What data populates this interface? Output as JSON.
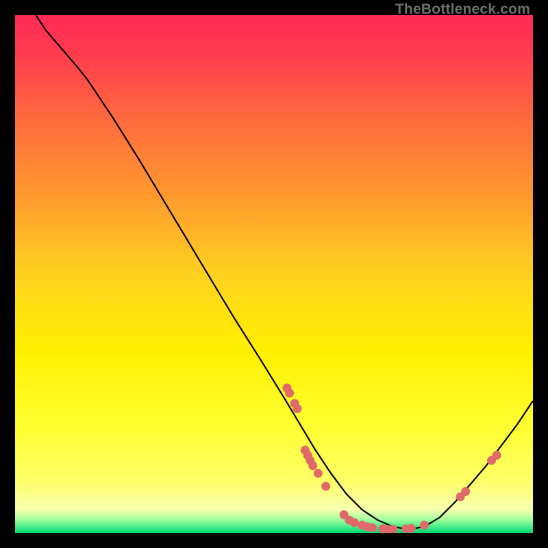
{
  "watermark": "TheBottleneck.com",
  "chart_data": {
    "type": "line",
    "title": "",
    "xlabel": "",
    "ylabel": "",
    "xlim": [
      0,
      100
    ],
    "ylim": [
      0,
      100
    ],
    "gradient_stops": [
      {
        "offset": 0.0,
        "color": "#ff2a55"
      },
      {
        "offset": 0.08,
        "color": "#ff3d4e"
      },
      {
        "offset": 0.2,
        "color": "#ff6a3e"
      },
      {
        "offset": 0.35,
        "color": "#ff9a2e"
      },
      {
        "offset": 0.5,
        "color": "#ffd11f"
      },
      {
        "offset": 0.65,
        "color": "#fff000"
      },
      {
        "offset": 0.8,
        "color": "#ffff33"
      },
      {
        "offset": 0.9,
        "color": "#fdff66"
      },
      {
        "offset": 0.955,
        "color": "#f8ffb0"
      },
      {
        "offset": 0.975,
        "color": "#9cff9c"
      },
      {
        "offset": 1.0,
        "color": "#00d973"
      }
    ],
    "curve": [
      {
        "x": 4.0,
        "y": 100.0
      },
      {
        "x": 6.0,
        "y": 97.0
      },
      {
        "x": 9.0,
        "y": 93.5
      },
      {
        "x": 12.0,
        "y": 90.0
      },
      {
        "x": 14.0,
        "y": 87.5
      },
      {
        "x": 16.0,
        "y": 84.5
      },
      {
        "x": 19.0,
        "y": 80.0
      },
      {
        "x": 24.0,
        "y": 72.0
      },
      {
        "x": 30.0,
        "y": 62.0
      },
      {
        "x": 36.0,
        "y": 52.0
      },
      {
        "x": 42.0,
        "y": 42.0
      },
      {
        "x": 48.0,
        "y": 32.5
      },
      {
        "x": 52.0,
        "y": 26.0
      },
      {
        "x": 55.0,
        "y": 21.0
      },
      {
        "x": 58.0,
        "y": 16.0
      },
      {
        "x": 61.0,
        "y": 11.5
      },
      {
        "x": 64.0,
        "y": 7.5
      },
      {
        "x": 67.0,
        "y": 4.5
      },
      {
        "x": 70.0,
        "y": 2.5
      },
      {
        "x": 73.0,
        "y": 1.2
      },
      {
        "x": 76.0,
        "y": 0.7
      },
      {
        "x": 79.0,
        "y": 1.2
      },
      {
        "x": 82.0,
        "y": 3.0
      },
      {
        "x": 85.0,
        "y": 6.0
      },
      {
        "x": 88.0,
        "y": 9.5
      },
      {
        "x": 91.0,
        "y": 13.0
      },
      {
        "x": 94.0,
        "y": 17.0
      },
      {
        "x": 97.0,
        "y": 21.0
      },
      {
        "x": 100.0,
        "y": 25.5
      }
    ],
    "scatter": [
      {
        "x": 52.5,
        "y": 28.0
      },
      {
        "x": 53.0,
        "y": 27.0
      },
      {
        "x": 54.0,
        "y": 25.0
      },
      {
        "x": 54.5,
        "y": 24.0
      },
      {
        "x": 56.0,
        "y": 16.0
      },
      {
        "x": 56.5,
        "y": 15.0
      },
      {
        "x": 57.0,
        "y": 14.0
      },
      {
        "x": 57.5,
        "y": 13.0
      },
      {
        "x": 58.5,
        "y": 11.5
      },
      {
        "x": 60.0,
        "y": 9.0
      },
      {
        "x": 63.5,
        "y": 3.5
      },
      {
        "x": 64.5,
        "y": 2.5
      },
      {
        "x": 65.5,
        "y": 2.0
      },
      {
        "x": 67.0,
        "y": 1.5
      },
      {
        "x": 68.0,
        "y": 1.2
      },
      {
        "x": 69.0,
        "y": 1.0
      },
      {
        "x": 71.0,
        "y": 0.8
      },
      {
        "x": 72.0,
        "y": 0.7
      },
      {
        "x": 73.0,
        "y": 0.7
      },
      {
        "x": 75.5,
        "y": 0.8
      },
      {
        "x": 76.5,
        "y": 0.9
      },
      {
        "x": 79.0,
        "y": 1.5
      },
      {
        "x": 86.0,
        "y": 7.0
      },
      {
        "x": 87.0,
        "y": 8.0
      },
      {
        "x": 92.0,
        "y": 14.0
      },
      {
        "x": 93.0,
        "y": 15.0
      }
    ],
    "scatter_color": "#e06a6a",
    "curve_color": "#000000"
  }
}
